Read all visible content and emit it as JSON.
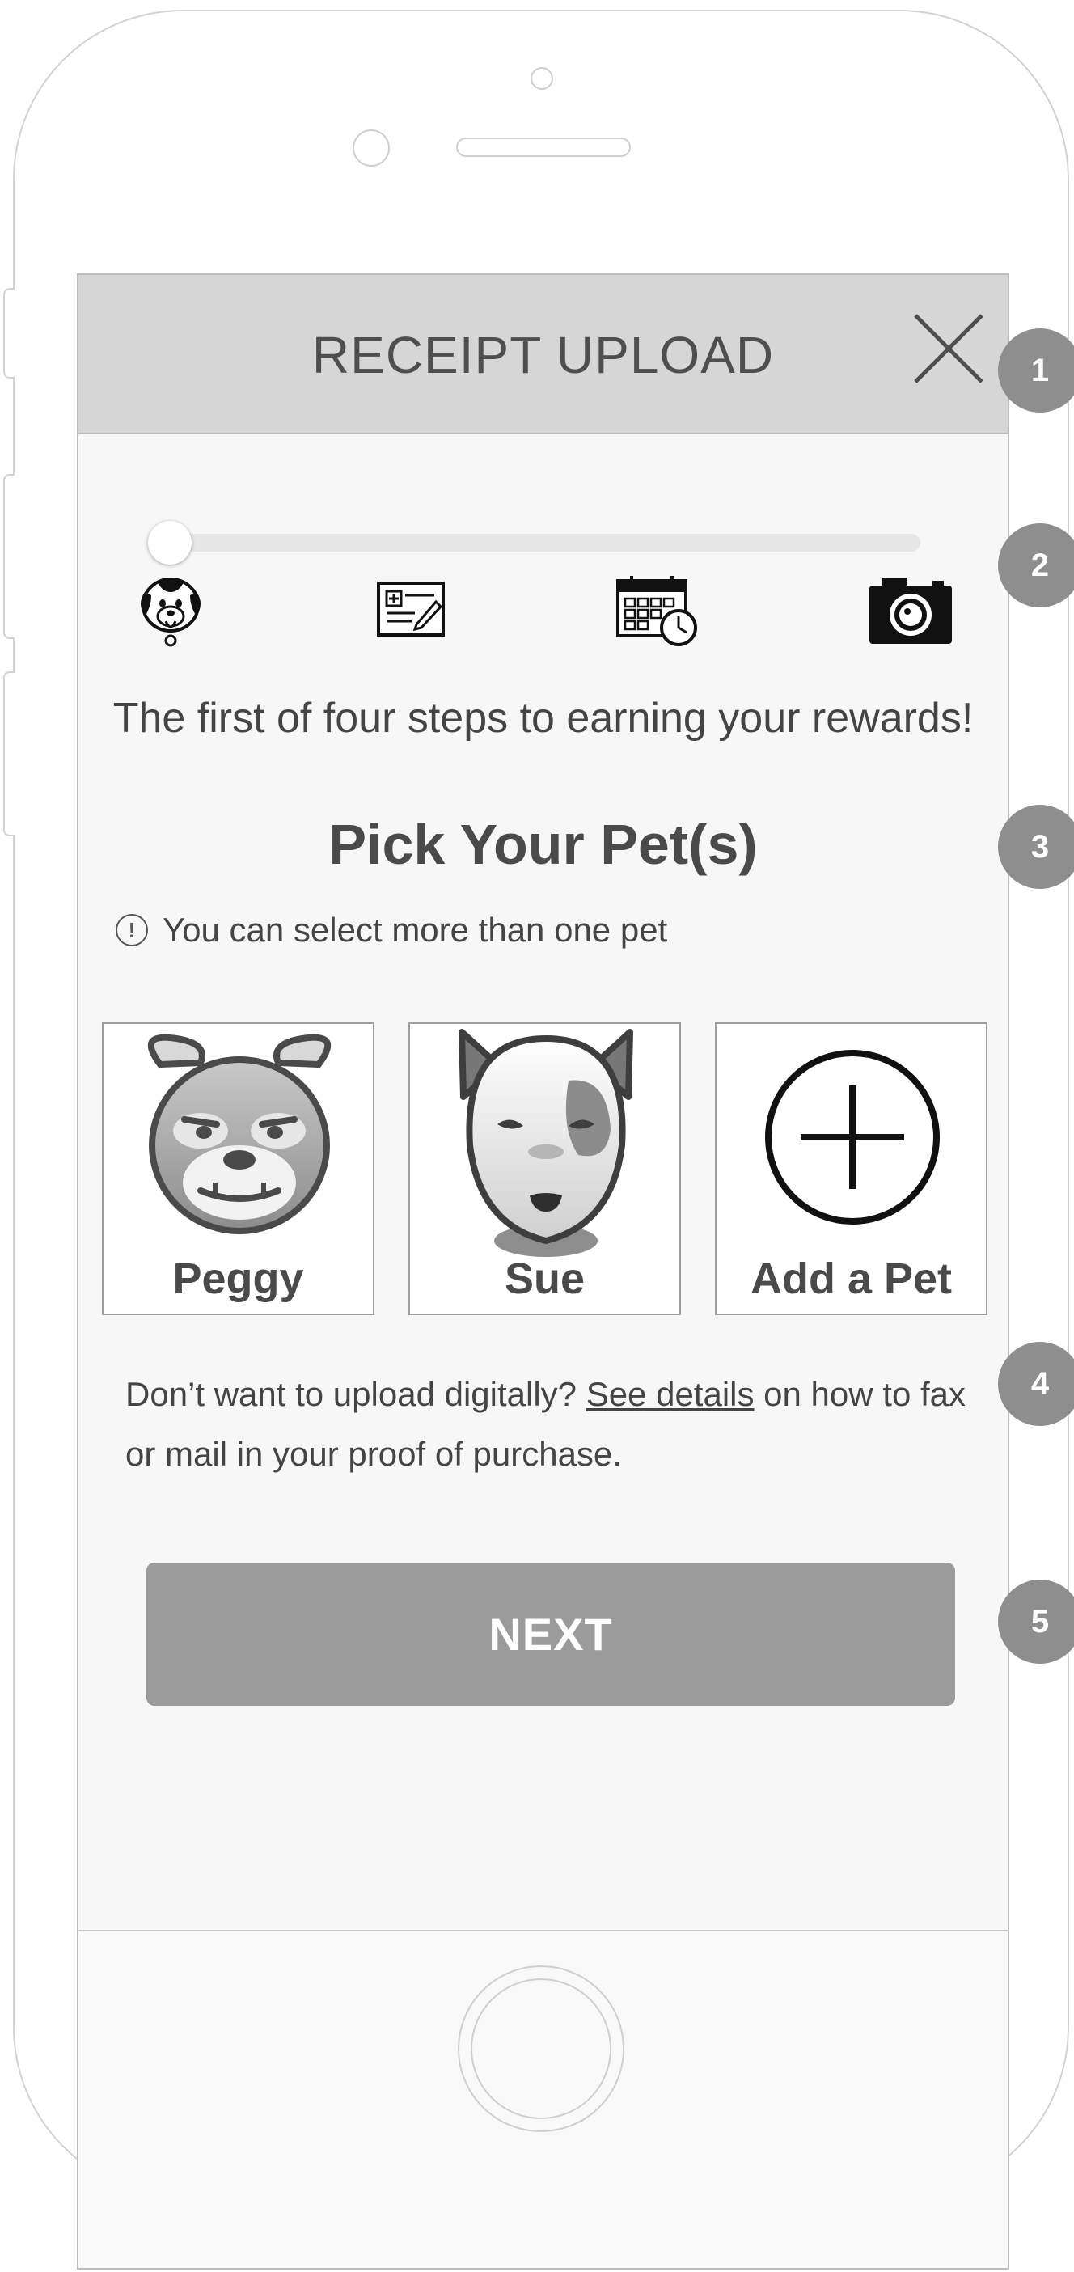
{
  "header": {
    "title": "RECEIPT UPLOAD",
    "close_icon": "close-icon"
  },
  "progress": {
    "current_step": 1,
    "total_steps": 4,
    "value": 0.0
  },
  "steps": [
    {
      "icon": "pet-dog-icon",
      "label": ""
    },
    {
      "icon": "receipt-icon",
      "label": ""
    },
    {
      "icon": "calendar-clock-icon",
      "label": ""
    },
    {
      "icon": "camera-icon",
      "label": ""
    }
  ],
  "intro": "The first of four steps to earning your rewards!",
  "section": {
    "title": "Pick Your Pet(s)",
    "hint_icon_glyph": "!",
    "hint": "You can select more than one pet"
  },
  "pets": [
    {
      "name": "Peggy",
      "icon": "bulldog-avatar"
    },
    {
      "name": "Sue",
      "icon": "spotted-dog-avatar"
    },
    {
      "name": "Add a Pet",
      "icon": "add-circle-icon"
    }
  ],
  "note": {
    "before": "Don’t want to upload digitally? ",
    "link": "See details",
    "after": " on how to fax or mail in your proof of purchase."
  },
  "next_button": "NEXT",
  "badges": [
    "1",
    "2",
    "3",
    "4",
    "5"
  ],
  "colors": {
    "header_bg": "#d6d6d6",
    "screen_bg": "#f7f7f7",
    "button_bg": "#9b9b9b",
    "badge_bg": "#8e8e8e"
  }
}
